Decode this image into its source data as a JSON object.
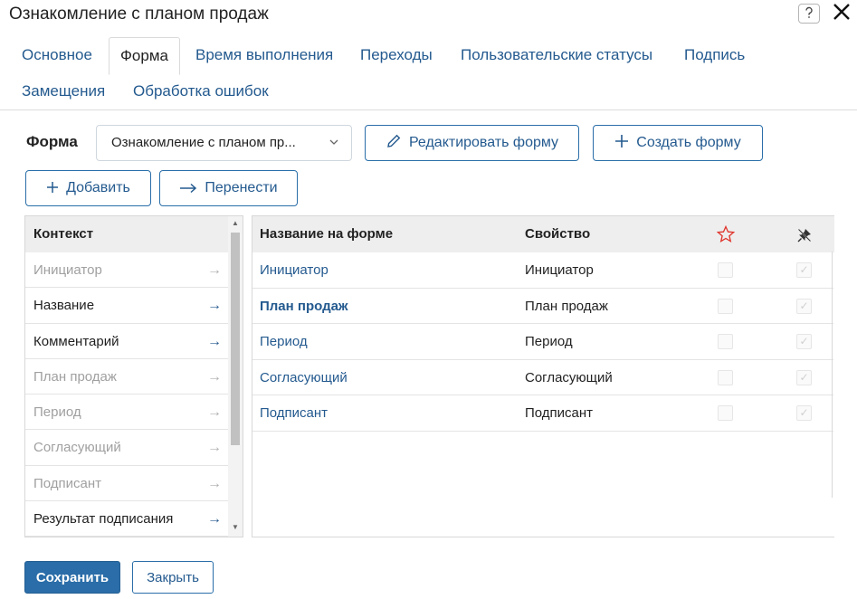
{
  "dialog": {
    "title": "Ознакомление с планом продаж",
    "help_icon": "question-icon",
    "close_icon": "close-icon"
  },
  "tabs": [
    {
      "label": "Основное"
    },
    {
      "label": "Форма"
    },
    {
      "label": "Время выполнения"
    },
    {
      "label": "Переходы"
    },
    {
      "label": "Пользовательские статусы"
    },
    {
      "label": "Подпись"
    },
    {
      "label": "Замещения"
    },
    {
      "label": "Обработка ошибок"
    }
  ],
  "active_tab": "Форма",
  "form": {
    "label": "Форма",
    "selected": "Ознакомление с планом пр...",
    "edit_label": "Редактировать форму",
    "create_label": "Создать форму",
    "add_label": "Добавить",
    "move_label": "Перенести"
  },
  "context": {
    "header": "Контекст",
    "items": [
      {
        "label": "Инициатор",
        "dim": true
      },
      {
        "label": "Название",
        "dim": false
      },
      {
        "label": "Комментарий",
        "dim": false
      },
      {
        "label": "План продаж",
        "dim": true
      },
      {
        "label": "Период",
        "dim": true
      },
      {
        "label": "Согласующий",
        "dim": true
      },
      {
        "label": "Подписант",
        "dim": true
      },
      {
        "label": "Результат подписания",
        "dim": false
      }
    ]
  },
  "fields": {
    "header_name": "Название на форме",
    "header_property": "Свойство",
    "required_icon": "star-icon",
    "readonly_icon": "pin-icon",
    "rows": [
      {
        "name": "Инициатор",
        "property": "Инициатор",
        "bold": false
      },
      {
        "name": "План продаж",
        "property": "План продаж",
        "bold": true
      },
      {
        "name": "Период",
        "property": "Период",
        "bold": false
      },
      {
        "name": "Согласующий",
        "property": "Согласующий",
        "bold": false
      },
      {
        "name": "Подписант",
        "property": "Подписант",
        "bold": false
      }
    ]
  },
  "footer": {
    "save_label": "Сохранить",
    "close_label": "Закрыть"
  },
  "colors": {
    "accent": "#2a6da8",
    "link": "#245a8f",
    "star": "#e0342c"
  }
}
